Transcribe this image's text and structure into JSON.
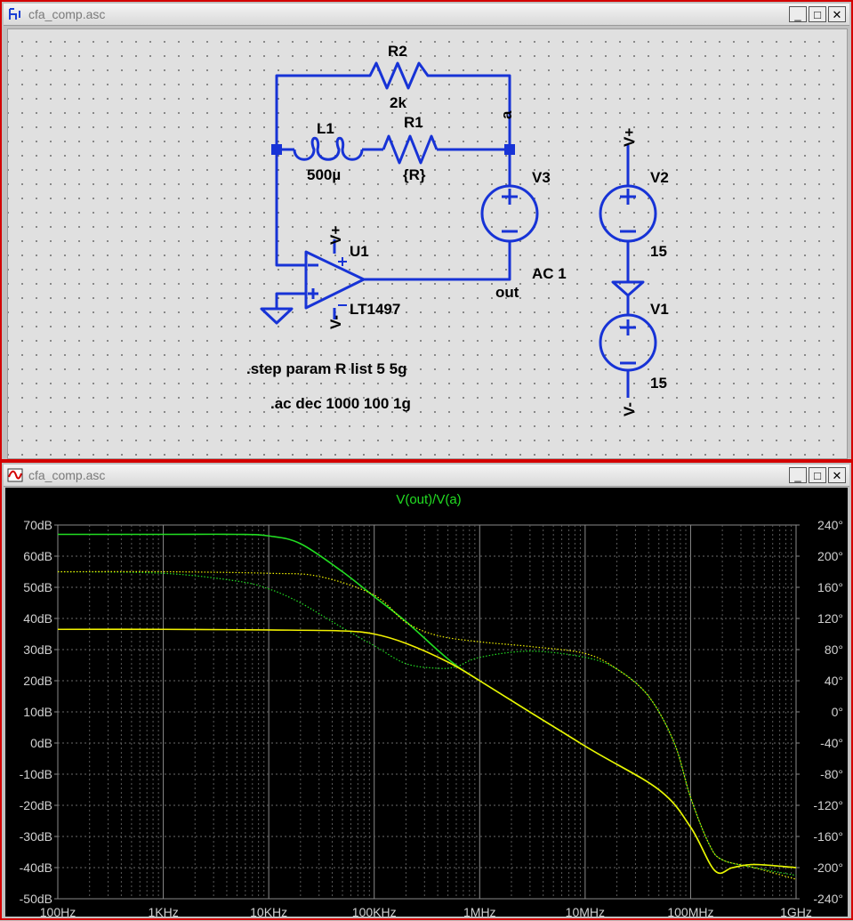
{
  "schematic_window": {
    "title": "cfa_comp.asc",
    "controls": {
      "minimize": "_",
      "restore": "□",
      "close": "✕"
    },
    "icon": "schematic-icon"
  },
  "schematic": {
    "R2": {
      "name": "R2",
      "value": "2k"
    },
    "L1": {
      "name": "L1",
      "value": "500µ"
    },
    "R1": {
      "name": "R1",
      "value": "{R}"
    },
    "V3": {
      "name": "V3",
      "value": "AC 1"
    },
    "V2": {
      "name": "V2",
      "value": "15"
    },
    "V1": {
      "name": "V1",
      "value": "15"
    },
    "U1": {
      "name": "U1",
      "value": "LT1497"
    },
    "net_a": "a",
    "net_out": "out",
    "vplus": "V+",
    "vminus": "V-",
    "directive_step": ".step param R list 5 5g",
    "directive_ac": ".ac dec 1000 100 1g"
  },
  "plot_window": {
    "title": "cfa_comp.asc",
    "controls": {
      "minimize": "_",
      "restore": "□",
      "close": "✕"
    },
    "icon": "waveform-icon"
  },
  "chart_data": {
    "type": "line",
    "title": "V(out)/V(a)",
    "x_scale": "log",
    "x_ticks": [
      "100Hz",
      "1KHz",
      "10KHz",
      "100KHz",
      "1MHz",
      "10MHz",
      "100MHz",
      "1GHz"
    ],
    "xlim": [
      100,
      1000000000
    ],
    "y_left_ticks": [
      "70dB",
      "60dB",
      "50dB",
      "40dB",
      "30dB",
      "20dB",
      "10dB",
      "0dB",
      "-10dB",
      "-20dB",
      "-30dB",
      "-40dB",
      "-50dB"
    ],
    "ylim_left": [
      -50,
      70
    ],
    "y_right_ticks": [
      "240°",
      "200°",
      "160°",
      "120°",
      "80°",
      "40°",
      "0°",
      "-40°",
      "-80°",
      "-120°",
      "-160°",
      "-200°",
      "-240°"
    ],
    "ylim_right": [
      -240,
      240
    ],
    "grid": true,
    "colors": {
      "green": "#22dd22",
      "yellow": "#f0f000",
      "title": "#22dd22",
      "axis_text": "#d0d0d0"
    },
    "series": [
      {
        "color": "green",
        "style": "solid",
        "axis": "left",
        "points": [
          [
            100,
            67
          ],
          [
            1000,
            67
          ],
          [
            5000,
            67
          ],
          [
            10000,
            66.5
          ],
          [
            20000,
            64
          ],
          [
            50000,
            55
          ],
          [
            100000,
            47
          ],
          [
            200000,
            39
          ],
          [
            500000,
            27
          ],
          [
            1000000,
            20
          ],
          [
            10000000,
            -1
          ],
          [
            50000000,
            -15
          ],
          [
            100000000,
            -27
          ],
          [
            170000000,
            -41
          ],
          [
            250000000,
            -40
          ],
          [
            400000000,
            -39
          ],
          [
            1000000000,
            -40
          ]
        ]
      },
      {
        "color": "green",
        "style": "dotted",
        "axis": "right",
        "points": [
          [
            100,
            180
          ],
          [
            1000,
            178
          ],
          [
            5000,
            168
          ],
          [
            10000,
            158
          ],
          [
            20000,
            140
          ],
          [
            50000,
            108
          ],
          [
            100000,
            85
          ],
          [
            200000,
            62
          ],
          [
            400000,
            56
          ],
          [
            600000,
            58
          ],
          [
            1000000,
            70
          ],
          [
            3000000,
            78
          ],
          [
            10000000,
            70
          ],
          [
            20000000,
            55
          ],
          [
            40000000,
            20
          ],
          [
            70000000,
            -40
          ],
          [
            100000000,
            -110
          ],
          [
            150000000,
            -170
          ],
          [
            200000000,
            -190
          ],
          [
            400000000,
            -200
          ],
          [
            1000000000,
            -210
          ]
        ]
      },
      {
        "color": "yellow",
        "style": "solid",
        "axis": "left",
        "points": [
          [
            100,
            36.5
          ],
          [
            1000,
            36.5
          ],
          [
            10000,
            36.3
          ],
          [
            50000,
            36
          ],
          [
            100000,
            35
          ],
          [
            200000,
            32
          ],
          [
            500000,
            26
          ],
          [
            1000000,
            20
          ],
          [
            10000000,
            -1
          ],
          [
            50000000,
            -15
          ],
          [
            100000000,
            -27
          ],
          [
            170000000,
            -41
          ],
          [
            250000000,
            -40
          ],
          [
            400000000,
            -39
          ],
          [
            1000000000,
            -40
          ]
        ]
      },
      {
        "color": "yellow",
        "style": "dotted",
        "axis": "right",
        "points": [
          [
            100,
            180
          ],
          [
            1000,
            180
          ],
          [
            10000,
            178
          ],
          [
            30000,
            174
          ],
          [
            100000,
            150
          ],
          [
            200000,
            115
          ],
          [
            400000,
            98
          ],
          [
            1000000,
            90
          ],
          [
            3000000,
            84
          ],
          [
            10000000,
            75
          ],
          [
            20000000,
            55
          ],
          [
            40000000,
            20
          ],
          [
            70000000,
            -40
          ],
          [
            100000000,
            -110
          ],
          [
            150000000,
            -170
          ],
          [
            200000000,
            -190
          ],
          [
            400000000,
            -200
          ],
          [
            1000000000,
            -215
          ]
        ]
      }
    ]
  }
}
